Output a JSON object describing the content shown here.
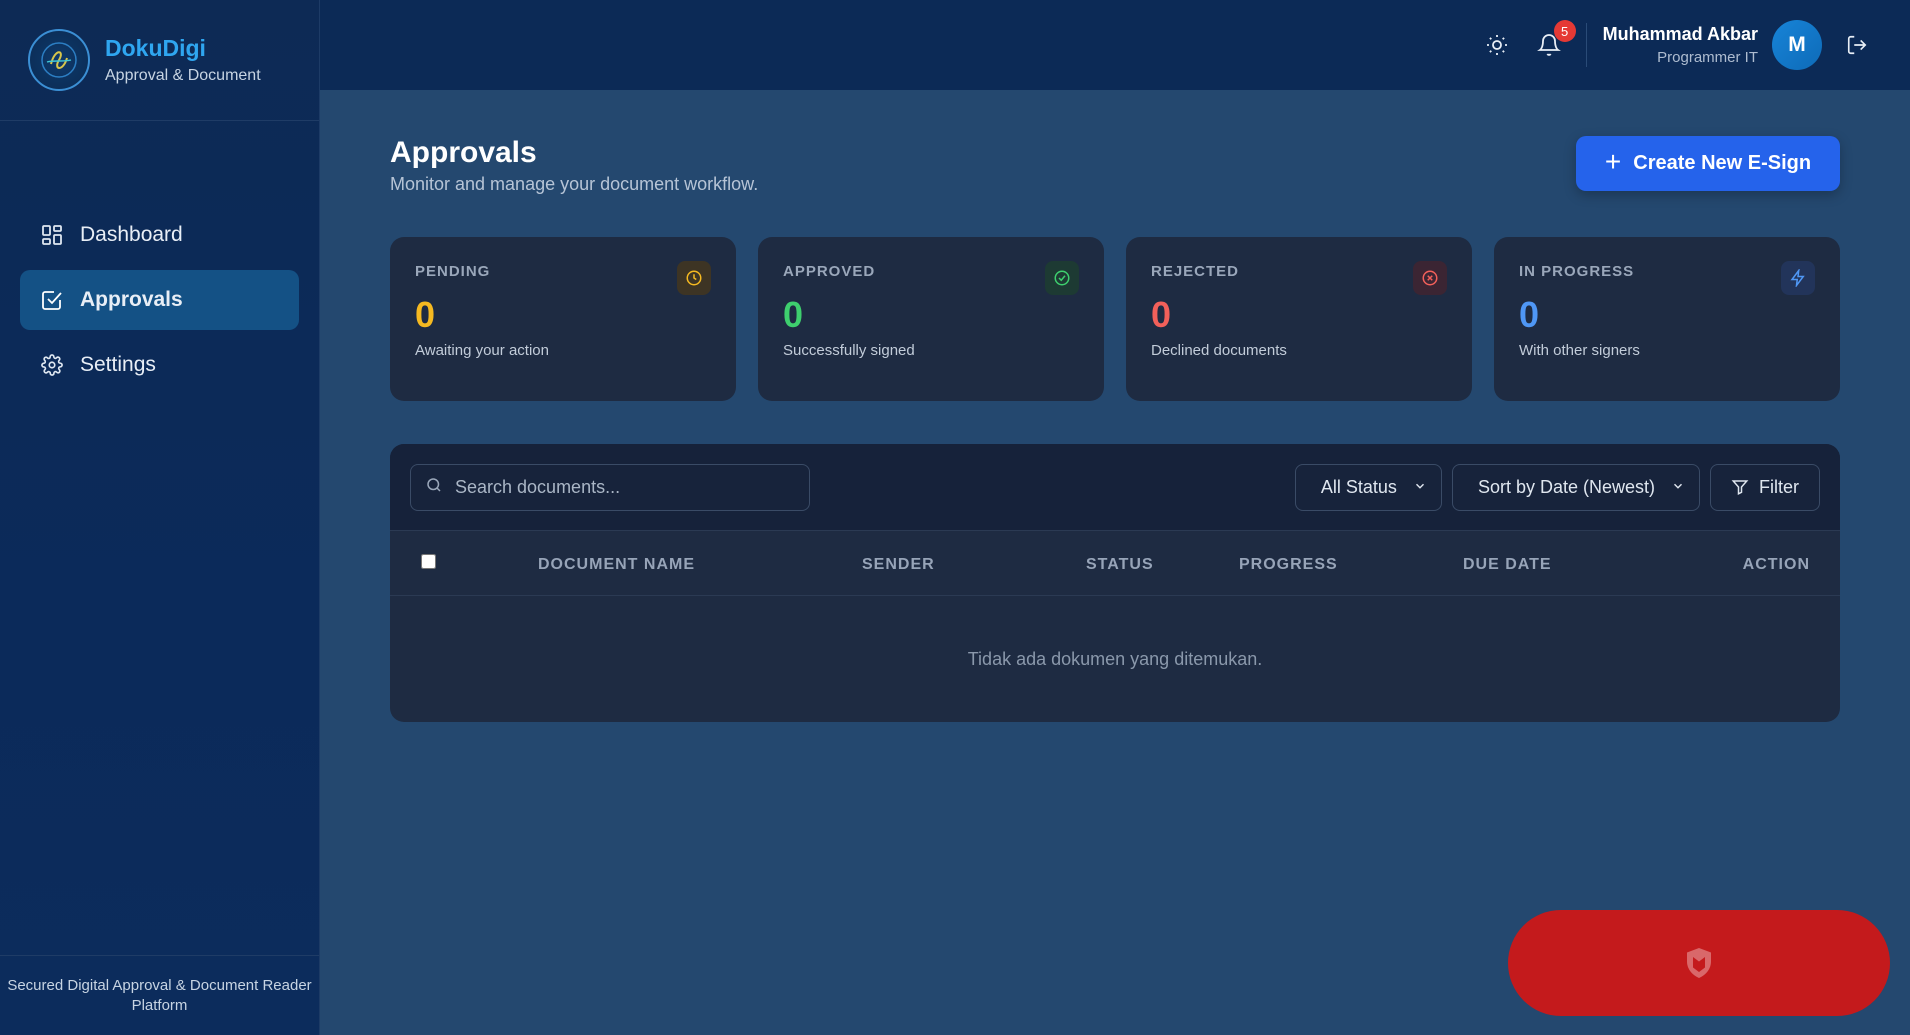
{
  "brand": {
    "name": "DokuDigi",
    "subtitle": "Approval & Document"
  },
  "sidebar": {
    "items": [
      {
        "label": "Dashboard",
        "icon": "dashboard-grid-icon",
        "active": false
      },
      {
        "label": "Approvals",
        "icon": "check-square-icon",
        "active": true
      },
      {
        "label": "Settings",
        "icon": "gear-icon",
        "active": false
      }
    ],
    "footer": "Secured Digital Approval & Document Reader Platform"
  },
  "header": {
    "notification_count": "5",
    "user_name": "Muhammad Akbar",
    "user_role": "Programmer IT",
    "avatar_initial": "M"
  },
  "page": {
    "title": "Approvals",
    "subtitle": "Monitor and manage your document workflow.",
    "create_label": "Create New E-Sign"
  },
  "cards": [
    {
      "label": "PENDING",
      "value": "0",
      "desc": "Awaiting your action",
      "color": "#f5b921",
      "icon": "clock-icon"
    },
    {
      "label": "APPROVED",
      "value": "0",
      "desc": "Successfully signed",
      "color": "#3ecf6e",
      "icon": "check-circle-icon"
    },
    {
      "label": "REJECTED",
      "value": "0",
      "desc": "Declined documents",
      "color": "#f2605a",
      "icon": "x-circle-icon"
    },
    {
      "label": "IN PROGRESS",
      "value": "0",
      "desc": "With other signers",
      "color": "#4f97f5",
      "icon": "lightning-icon"
    }
  ],
  "table": {
    "search_placeholder": "Search documents...",
    "status_filter": "All Status",
    "sort": "Sort by Date (Newest)",
    "filter_label": "Filter",
    "columns": [
      "DOCUMENT NAME",
      "SENDER",
      "STATUS",
      "PROGRESS",
      "DUE DATE",
      "ACTION"
    ],
    "empty_message": "Tidak ada dokumen yang ditemukan."
  },
  "colors": {
    "accent": "#2563eb",
    "sidebar_active": "#145185",
    "floating_badge": "#c41a1c"
  }
}
